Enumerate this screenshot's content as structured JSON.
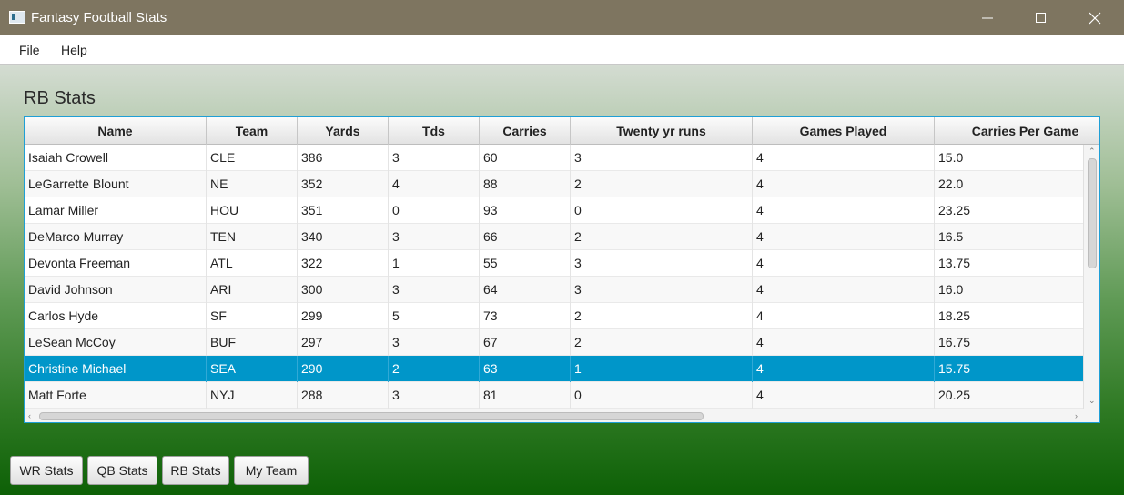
{
  "window": {
    "title": "Fantasy Football Stats"
  },
  "menu": {
    "items": [
      "File",
      "Help"
    ]
  },
  "heading": "RB Stats",
  "table": {
    "columns": [
      "Name",
      "Team",
      "Yards",
      "Tds",
      "Carries",
      "Twenty yr runs",
      "Games Played",
      "Carries Per Game"
    ],
    "rows": [
      [
        "Isaiah Crowell",
        "CLE",
        "386",
        "3",
        "60",
        "3",
        "4",
        "15.0"
      ],
      [
        "LeGarrette Blount",
        "NE",
        "352",
        "4",
        "88",
        "2",
        "4",
        "22.0"
      ],
      [
        "Lamar Miller",
        "HOU",
        "351",
        "0",
        "93",
        "0",
        "4",
        "23.25"
      ],
      [
        "DeMarco Murray",
        "TEN",
        "340",
        "3",
        "66",
        "2",
        "4",
        "16.5"
      ],
      [
        "Devonta Freeman",
        "ATL",
        "322",
        "1",
        "55",
        "3",
        "4",
        "13.75"
      ],
      [
        "David Johnson",
        "ARI",
        "300",
        "3",
        "64",
        "3",
        "4",
        "16.0"
      ],
      [
        "Carlos Hyde",
        "SF",
        "299",
        "5",
        "73",
        "2",
        "4",
        "18.25"
      ],
      [
        "LeSean McCoy",
        "BUF",
        "297",
        "3",
        "67",
        "2",
        "4",
        "16.75"
      ],
      [
        "Christine Michael",
        "SEA",
        "290",
        "2",
        "63",
        "1",
        "4",
        "15.75"
      ],
      [
        "Matt Forte",
        "NYJ",
        "288",
        "3",
        "81",
        "0",
        "4",
        "20.25"
      ]
    ],
    "selected_row": 8
  },
  "nav_buttons": [
    "WR Stats",
    "QB Stats",
    "RB Stats",
    "My Team"
  ],
  "colors": {
    "titlebar": "#7e7560",
    "selection": "#0096c9",
    "focus_border": "#1f9fd6",
    "gradient_bottom": "#0d6006"
  }
}
